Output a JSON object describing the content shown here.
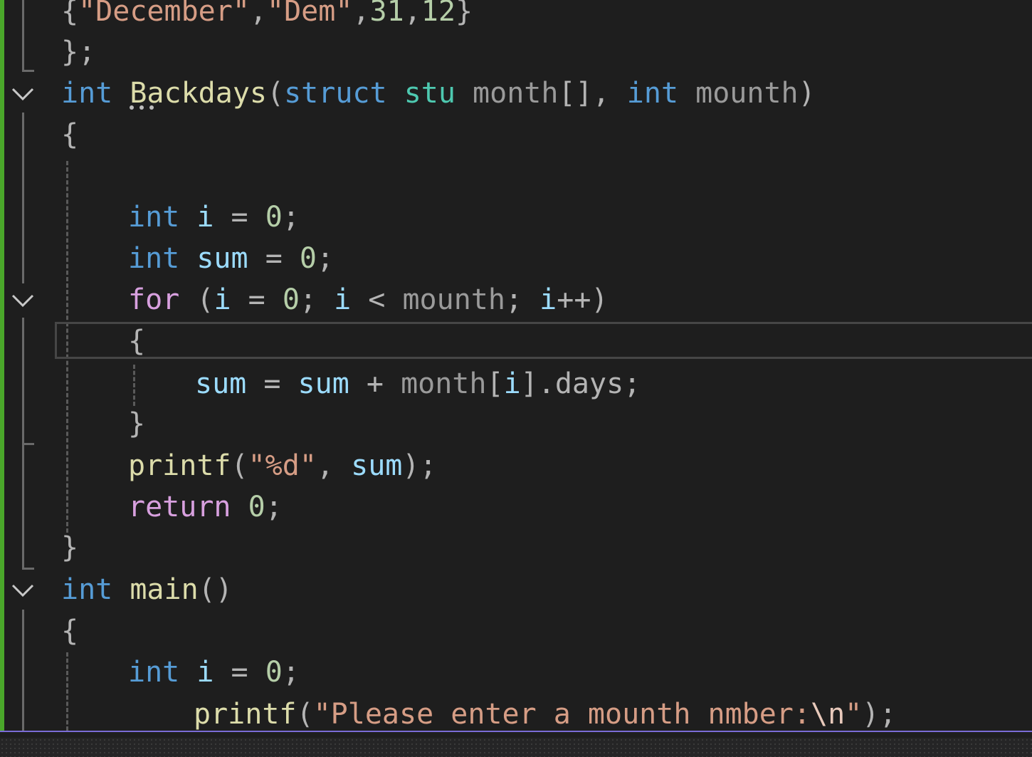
{
  "editor": {
    "accent_colors": {
      "keyword": "#569cd6",
      "control": "#d8a0df",
      "type": "#4ec9b0",
      "function": "#dcdcaa",
      "variable": "#9cdcfe",
      "parameter": "#9a9a9a",
      "string": "#d69d85",
      "number": "#b5cea8",
      "change_bar": "#4aa72a",
      "background": "#1e1e1e"
    },
    "lines": {
      "l1": {
        "brace_open": "{",
        "str1": "\"December\"",
        "comma1": ",",
        "str2": "\"Dem\"",
        "comma2": ",",
        "num1": "31",
        "comma3": ",",
        "num2": "12",
        "brace_close": "}"
      },
      "l2": {
        "text": "};"
      },
      "l3": {
        "kw_int": "int",
        "fn_name": "Backdays",
        "p1": "(",
        "kw_struct": "struct",
        "type_name": "stu",
        "param_month": "month",
        "brackets": "[],",
        "kw_int2": "int",
        "param_mounth": "mounth",
        "p2": ")"
      },
      "l4": {
        "text": "{"
      },
      "l5": {
        "kw": "int",
        "var": "i",
        "op": "=",
        "num": "0",
        "semi": ";"
      },
      "l6": {
        "kw": "int",
        "var": "sum",
        "op": "=",
        "num": "0",
        "semi": ";"
      },
      "l7": {
        "kw_for": "for",
        "p1": "(",
        "var1": "i",
        "op1": "=",
        "num": "0",
        "semi1": ";",
        "var2": "i",
        "op2": "<",
        "param": "mounth",
        "semi2": ";",
        "var3": "i",
        "inc": "++",
        "p2": ")"
      },
      "l8": {
        "text": "{"
      },
      "l9": {
        "var1": "sum",
        "op1": "=",
        "var2": "sum",
        "op2": "+",
        "param": "month",
        "b1": "[",
        "idx": "i",
        "b2": "].",
        "member": "days",
        "semi": ";"
      },
      "l10": {
        "text": "}"
      },
      "l11": {
        "fn": "printf",
        "p1": "(",
        "str": "\"%d\"",
        "comma": ",",
        "var": "sum",
        "p2": ");"
      },
      "l12": {
        "kw_return": "return",
        "num": "0",
        "semi": ";"
      },
      "l13": {
        "text": "}"
      },
      "l14": {
        "kw_int": "int",
        "fn_name": "main",
        "parens": "()"
      },
      "l15": {
        "text": "{"
      },
      "l16": {
        "kw": "int",
        "var": "i",
        "op": "=",
        "num": "0",
        "semi": ";"
      },
      "l17": {
        "fn": "printf",
        "p1": "(",
        "str_open": "\"Please enter a mounth nmber:",
        "esc": "\\n",
        "str_close": "\"",
        "p2": ");"
      }
    },
    "fold_icons": [
      "chevron-down-icon",
      "chevron-down-icon",
      "chevron-down-icon"
    ]
  }
}
